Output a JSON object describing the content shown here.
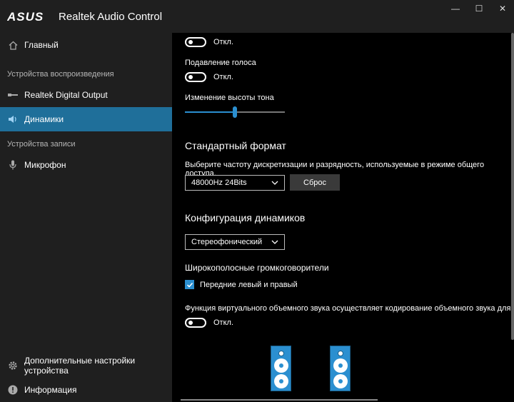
{
  "app": {
    "title": "Realtek Audio Control",
    "brand": "ASUS"
  },
  "window_controls": {
    "minimize": "—",
    "maximize": "☐",
    "close": "✕"
  },
  "sidebar": {
    "main_item": "Главный",
    "playback_section": "Устройства воспроизведения",
    "playback_devices": [
      "Realtek Digital Output",
      "Динамики"
    ],
    "record_section": "Устройства записи",
    "record_devices": [
      "Микрофон"
    ],
    "bottom_items": [
      "Дополнительные настройки устройства",
      "Информация"
    ],
    "active_item": "Динамики"
  },
  "main": {
    "toggle1": {
      "state": "Откл."
    },
    "voice_suppression": {
      "label": "Подавление голоса",
      "state": "Откл."
    },
    "pitch": {
      "label": "Изменение высоты тона",
      "value_fraction": 0.5
    },
    "default_format": {
      "heading": "Стандартный формат",
      "description": "Выберите частоту дискретизации и разрядность, используемые в режиме общего доступа.",
      "selected": "48000Hz 24Bits",
      "reset_label": "Сброс"
    },
    "speaker_config": {
      "heading": "Конфигурация динамиков",
      "selected": "Стереофонический"
    },
    "fullrange": {
      "label": "Широкополосные громкоговорители",
      "checkbox_label": "Передние левый и правый",
      "checked": true
    },
    "virtual_surround": {
      "label": "Функция виртуального объемного звука осуществляет кодирование объемного звука для пере",
      "state": "Откл."
    }
  },
  "colors": {
    "accent": "#2b8fd0",
    "sidebar_bg": "#1f1f1f",
    "active_bg": "#1f6f9a",
    "content_bg": "#000000"
  }
}
